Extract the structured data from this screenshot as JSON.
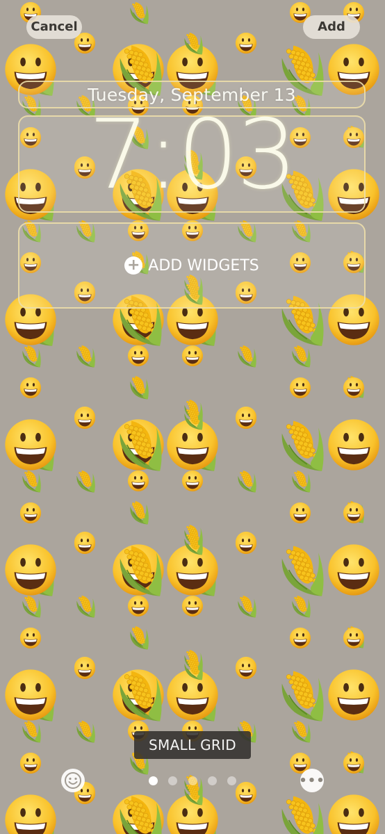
{
  "header": {
    "cancel_label": "Cancel",
    "add_label": "Add"
  },
  "lock_screen": {
    "date": "Tuesday, September 13",
    "time": "7:03",
    "add_widgets_label": "ADD WIDGETS"
  },
  "wallpaper": {
    "style_name": "SMALL GRID",
    "emoji": [
      "grinning-face-emoji",
      "ear-of-corn-emoji"
    ],
    "background_color": "#aba59d"
  },
  "controls": {
    "emoji_picker_icon": "smiley-icon",
    "more_icon": "ellipsis-icon",
    "more_label": "•••"
  },
  "pagination": {
    "count": 5,
    "active_index": 0
  }
}
